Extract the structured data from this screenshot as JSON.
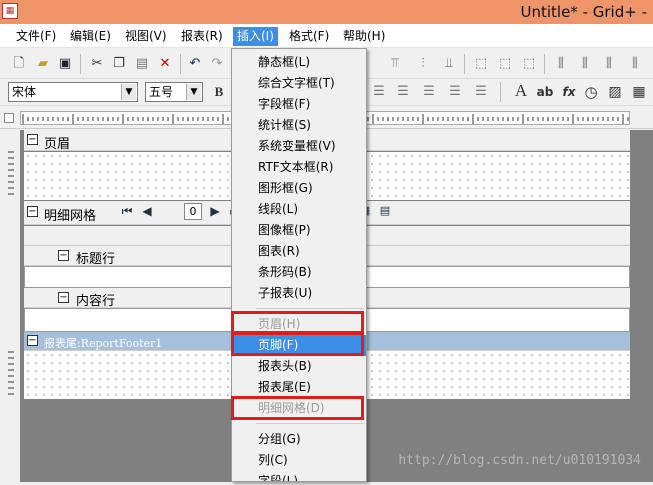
{
  "window": {
    "title": "Untitle* - Grid+ -",
    "app_icon": "report-app-icon"
  },
  "menubar": [
    {
      "label": "文件(F)"
    },
    {
      "label": "编辑(E)"
    },
    {
      "label": "视图(V)"
    },
    {
      "label": "报表(R)"
    },
    {
      "label": "插入(I)",
      "open": true
    },
    {
      "label": "格式(F)"
    },
    {
      "label": "帮助(H)"
    }
  ],
  "toolbar": {
    "font_name": "宋体",
    "font_size": "五号",
    "bold_label": "B",
    "text_icons": {
      "a_big": "A",
      "ab": "ab",
      "fx": "fx"
    }
  },
  "bands": {
    "page_header": {
      "label": "页眉"
    },
    "detail_grid": {
      "label": "明细网格",
      "page_value": "0"
    },
    "title_row": {
      "label": "标题行"
    },
    "content_row": {
      "label": "内容行"
    },
    "report_footer": {
      "label": "报表尾:ReportFooter1"
    }
  },
  "insert_menu": {
    "items": [
      {
        "label": "静态框(L)",
        "state": "normal"
      },
      {
        "label": "综合文字框(T)",
        "state": "normal"
      },
      {
        "label": "字段框(F)",
        "state": "normal"
      },
      {
        "label": "统计框(S)",
        "state": "normal"
      },
      {
        "label": "系统变量框(V)",
        "state": "normal"
      },
      {
        "label": "RTF文本框(R)",
        "state": "normal"
      },
      {
        "label": "图形框(G)",
        "state": "normal"
      },
      {
        "label": "线段(L)",
        "state": "normal"
      },
      {
        "label": "图像框(P)",
        "state": "normal"
      },
      {
        "label": "图表(R)",
        "state": "normal"
      },
      {
        "label": "条形码(B)",
        "state": "normal"
      },
      {
        "label": "子报表(U)",
        "state": "normal"
      },
      {
        "label": "页眉(H)",
        "state": "disabled"
      },
      {
        "label": "页脚(F)",
        "state": "selected"
      },
      {
        "label": "报表头(B)",
        "state": "normal"
      },
      {
        "label": "报表尾(E)",
        "state": "normal"
      },
      {
        "label": "明细网格(D)",
        "state": "disabled"
      },
      {
        "label": "分组(G)",
        "state": "normal"
      },
      {
        "label": "列(C)",
        "state": "normal"
      },
      {
        "label": "字段(L)",
        "state": "normal"
      }
    ]
  },
  "watermark": "http://blog.csdn.net/u010191034",
  "colors": {
    "title_bar": "#ef9468",
    "menu_highlight": "#3c8fe4",
    "footer_band": "#a5bfdd",
    "annotation_red": "#e21b1b"
  }
}
